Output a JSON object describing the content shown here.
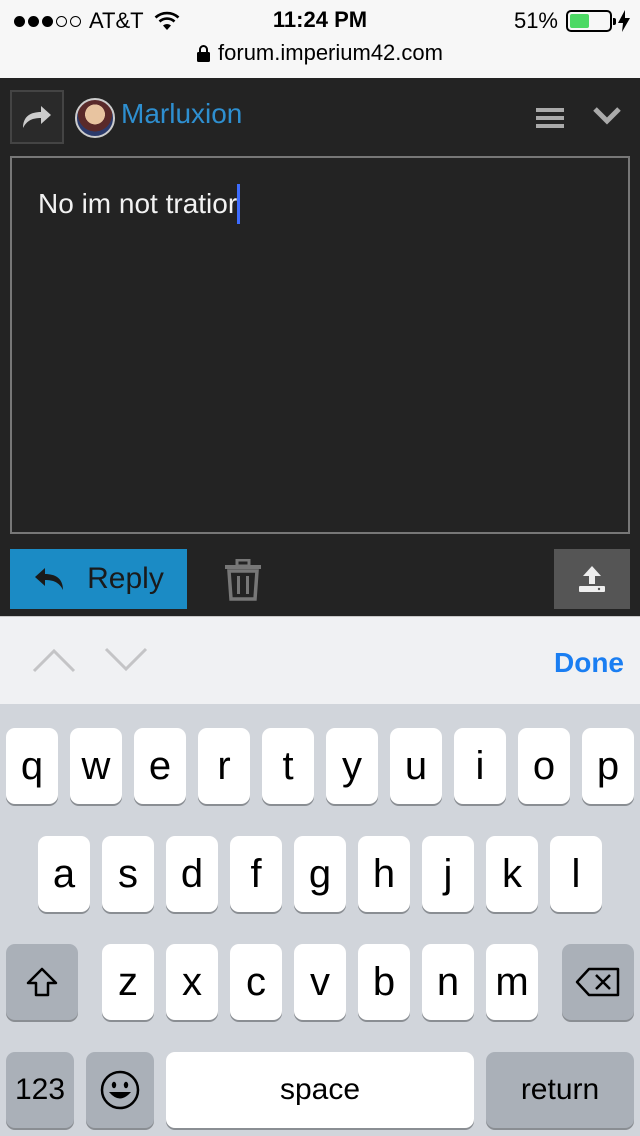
{
  "status_bar": {
    "carrier": "AT&T",
    "signal_bars_filled": 3,
    "signal_bars_total": 5,
    "time": "11:24 PM",
    "battery_percent": "51%",
    "battery_level": 0.51,
    "url": "forum.imperium42.com"
  },
  "editor": {
    "username": "Marluxion",
    "text": "No im not tratior",
    "reply_label": "Reply"
  },
  "accessory": {
    "done_label": "Done"
  },
  "keyboard": {
    "row1": [
      "q",
      "w",
      "e",
      "r",
      "t",
      "y",
      "u",
      "i",
      "o",
      "p"
    ],
    "row2": [
      "a",
      "s",
      "d",
      "f",
      "g",
      "h",
      "j",
      "k",
      "l"
    ],
    "row3": [
      "z",
      "x",
      "c",
      "v",
      "b",
      "n",
      "m"
    ],
    "numbers_label": "123",
    "space_label": "space",
    "return_label": "return"
  },
  "colors": {
    "accent": "#1b8bc5",
    "link": "#2e8fd0",
    "done": "#1a7ef2",
    "caret": "#3d6cff",
    "battery": "#4cd964"
  }
}
